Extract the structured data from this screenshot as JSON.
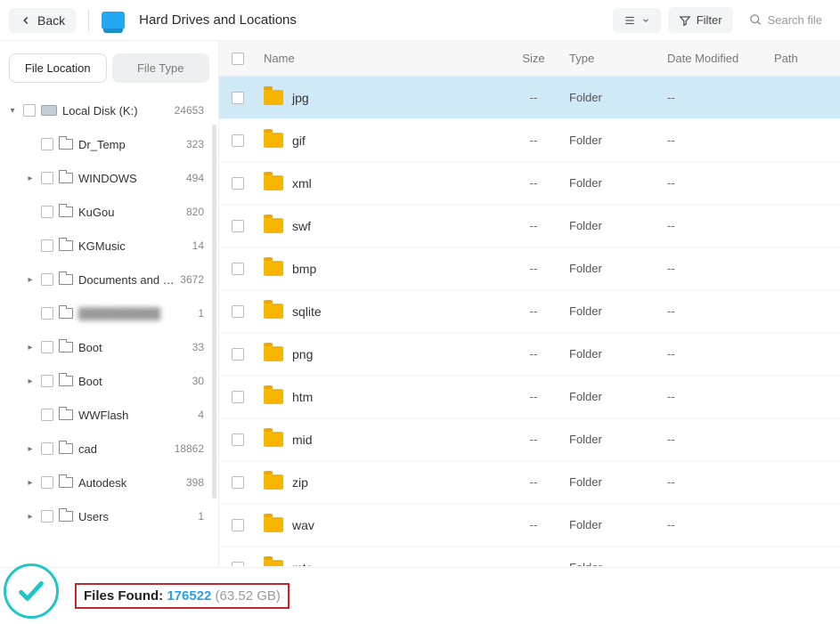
{
  "toolbar": {
    "back_label": "Back",
    "title": "Hard Drives and Locations",
    "filter_label": "Filter",
    "search_placeholder": "Search file"
  },
  "sidebar": {
    "tabs": {
      "location": "File Location",
      "type": "File Type"
    },
    "items": [
      {
        "label": "Local Disk (K:)",
        "count": "24653",
        "expand": true,
        "icon": "hdd",
        "depth": 0
      },
      {
        "label": "Dr_Temp",
        "count": "323",
        "expand": false,
        "icon": "folder",
        "depth": 1,
        "nochev": true
      },
      {
        "label": "WINDOWS",
        "count": "494",
        "expand": true,
        "icon": "folder",
        "depth": 1
      },
      {
        "label": "KuGou",
        "count": "820",
        "expand": false,
        "icon": "folder",
        "depth": 1,
        "nochev": true
      },
      {
        "label": "KGMusic",
        "count": "14",
        "expand": false,
        "icon": "folder",
        "depth": 1,
        "nochev": true
      },
      {
        "label": "Documents and Set...",
        "count": "3672",
        "expand": true,
        "icon": "folder",
        "depth": 1
      },
      {
        "label": "██████████",
        "count": "1",
        "expand": false,
        "icon": "folder",
        "depth": 1,
        "nochev": true,
        "blur": true
      },
      {
        "label": "Boot",
        "count": "33",
        "expand": true,
        "icon": "folder",
        "depth": 1
      },
      {
        "label": "Boot",
        "count": "30",
        "expand": true,
        "icon": "folder",
        "depth": 1
      },
      {
        "label": "WWFlash",
        "count": "4",
        "expand": false,
        "icon": "folder",
        "depth": 1,
        "nochev": true
      },
      {
        "label": "cad",
        "count": "18862",
        "expand": true,
        "icon": "folder",
        "depth": 1
      },
      {
        "label": "Autodesk",
        "count": "398",
        "expand": true,
        "icon": "folder",
        "depth": 1
      },
      {
        "label": "Users",
        "count": "1",
        "expand": true,
        "icon": "folder",
        "depth": 1
      }
    ]
  },
  "list": {
    "headers": {
      "name": "Name",
      "size": "Size",
      "type": "Type",
      "date": "Date Modified",
      "path": "Path"
    },
    "rows": [
      {
        "name": "jpg",
        "size": "--",
        "type": "Folder",
        "date": "--",
        "selected": true
      },
      {
        "name": "gif",
        "size": "--",
        "type": "Folder",
        "date": "--"
      },
      {
        "name": "xml",
        "size": "--",
        "type": "Folder",
        "date": "--"
      },
      {
        "name": "swf",
        "size": "--",
        "type": "Folder",
        "date": "--"
      },
      {
        "name": "bmp",
        "size": "--",
        "type": "Folder",
        "date": "--"
      },
      {
        "name": "sqlite",
        "size": "--",
        "type": "Folder",
        "date": "--"
      },
      {
        "name": "png",
        "size": "--",
        "type": "Folder",
        "date": "--"
      },
      {
        "name": "htm",
        "size": "--",
        "type": "Folder",
        "date": "--"
      },
      {
        "name": "mid",
        "size": "--",
        "type": "Folder",
        "date": "--"
      },
      {
        "name": "zip",
        "size": "--",
        "type": "Folder",
        "date": "--"
      },
      {
        "name": "wav",
        "size": "--",
        "type": "Folder",
        "date": "--"
      },
      {
        "name": "mtc",
        "size": "--",
        "type": "Folder",
        "date": "--"
      }
    ]
  },
  "footer": {
    "found_label": "Files Found: ",
    "found_count": "176522",
    "found_size": " (63.52 GB)"
  }
}
